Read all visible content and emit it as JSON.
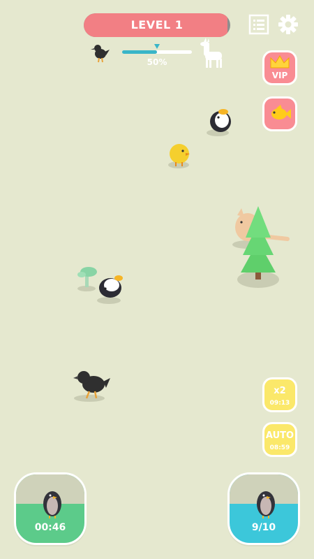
{
  "header": {
    "level_label": "LEVEL 1",
    "level_fill_fraction": 0.98,
    "list_icon": "list-icon",
    "settings_icon": "gear-icon"
  },
  "progress": {
    "value_fraction": 0.5,
    "label": "50%",
    "start_animal_icon": "crow-icon",
    "goal_animal_icon": "llama-icon"
  },
  "side_buttons": {
    "vip_label": "VIP",
    "fish_icon": "goldfish-icon"
  },
  "boosts": [
    {
      "label": "x2",
      "timer": "09:13"
    },
    {
      "label": "AUTO",
      "timer": "08:59"
    }
  ],
  "cards": {
    "left": {
      "timer": "00:46",
      "animal_icon": "penguin-icon",
      "color": "#5ccb8a"
    },
    "right": {
      "count": "9/10",
      "animal_icon": "penguin-icon",
      "color": "#3cc7da"
    }
  },
  "colors": {
    "background": "#e5e8cf",
    "level_bar": "#f27f84",
    "progress": "#39b5c8",
    "pink_button": "#f98c93",
    "yellow_button": "#fbe86a"
  }
}
